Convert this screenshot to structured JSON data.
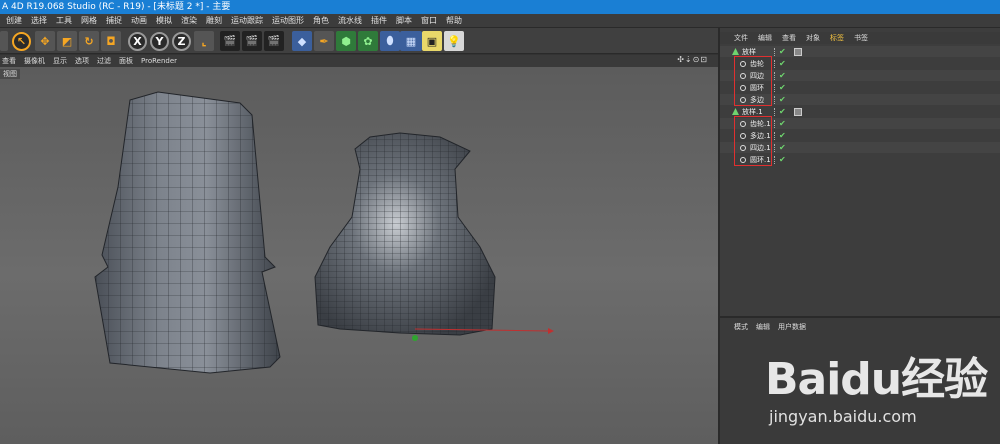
{
  "window": {
    "title": "A 4D R19.068 Studio (RC - R19) - [未标题 2 *] - 主要"
  },
  "menu": {
    "items": [
      "创建",
      "选择",
      "工具",
      "网格",
      "捕捉",
      "动画",
      "模拟",
      "渲染",
      "雕刻",
      "运动跟踪",
      "运动图形",
      "角色",
      "流水线",
      "插件",
      "脚本",
      "窗口",
      "帮助"
    ]
  },
  "toolbar": {
    "axis_x": "X",
    "axis_y": "Y",
    "axis_z": "Z"
  },
  "view_menu": {
    "items": [
      "查看",
      "摄像机",
      "显示",
      "选项",
      "过滤",
      "面板",
      "ProRender"
    ],
    "view_label": "视图",
    "nav_icons": "✣⇣⊙⊡"
  },
  "object_manager": {
    "tabs": [
      "文件",
      "编辑",
      "查看",
      "对象",
      "标签",
      "书签"
    ],
    "active_tab": "标签",
    "rows": [
      {
        "name": "放样",
        "level": 0
      },
      {
        "name": "齿轮",
        "level": 1
      },
      {
        "name": "四边",
        "level": 1
      },
      {
        "name": "圆环",
        "level": 1
      },
      {
        "name": "多边",
        "level": 1
      },
      {
        "name": "放样.1",
        "level": 0
      },
      {
        "name": "齿轮.1",
        "level": 1
      },
      {
        "name": "多边.1",
        "level": 1
      },
      {
        "name": "四边.1",
        "level": 1
      },
      {
        "name": "圆环.1",
        "level": 1
      }
    ]
  },
  "attribute_manager": {
    "tabs": [
      "模式",
      "编辑",
      "用户数据"
    ]
  },
  "watermark": {
    "brand": "Baidu经验",
    "url": "jingyan.baidu.com"
  }
}
